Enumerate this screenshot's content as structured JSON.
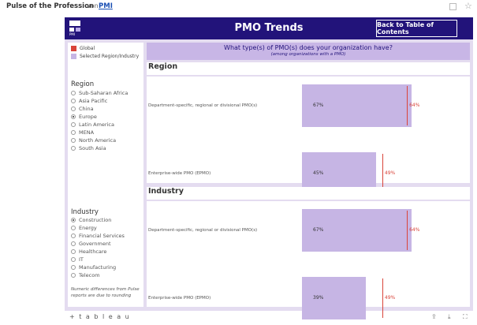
{
  "topbar": {
    "title": "Pulse of the Profession",
    "von": "von",
    "author": "PMI",
    "copy_icon": "copy-icon",
    "star_icon": "☆"
  },
  "header": {
    "logo_text": "PMI",
    "title": "PMO Trends",
    "back_button": "Back to Table of Contents"
  },
  "legend": [
    {
      "label": "Global",
      "color": "#d9443a"
    },
    {
      "label": "Selected Region/Industry",
      "color": "#c6b5e4"
    }
  ],
  "region": {
    "label": "Region",
    "items": [
      {
        "label": "Sub-Saharan Africa",
        "selected": false
      },
      {
        "label": "Asia Pacific",
        "selected": false
      },
      {
        "label": "China",
        "selected": false
      },
      {
        "label": "Europe",
        "selected": true
      },
      {
        "label": "Latin America",
        "selected": false
      },
      {
        "label": "MENA",
        "selected": false
      },
      {
        "label": "North America",
        "selected": false
      },
      {
        "label": "South Asia",
        "selected": false
      }
    ]
  },
  "industry": {
    "label": "Industry",
    "items": [
      {
        "label": "Construction",
        "selected": true
      },
      {
        "label": "Energy",
        "selected": false
      },
      {
        "label": "Financial Services",
        "selected": false
      },
      {
        "label": "Government",
        "selected": false
      },
      {
        "label": "Healthcare",
        "selected": false
      },
      {
        "label": "IT",
        "selected": false
      },
      {
        "label": "Manufacturing",
        "selected": false
      },
      {
        "label": "Telecom",
        "selected": false
      }
    ]
  },
  "note": "Numeric differences from Pulse reports are due to rounding",
  "question": {
    "title": "What type(s) of PMO(s) does your organization have?",
    "subtitle": "(among organizations with a PMO)"
  },
  "sections": {
    "region": {
      "title": "Region",
      "rows": [
        {
          "label": "Department-specific, regional or divisional PMO(s)",
          "value": 67,
          "value_label": "67%",
          "global": 64,
          "global_label": "64%"
        },
        {
          "label": "Enterprise-wide PMO (EPMO)",
          "value": 45,
          "value_label": "45%",
          "global": 49,
          "global_label": "49%"
        }
      ]
    },
    "industry": {
      "title": "Industry",
      "rows": [
        {
          "label": "Department-specific, regional or divisional PMO(s)",
          "value": 67,
          "value_label": "67%",
          "global": 64,
          "global_label": "64%"
        },
        {
          "label": "Enterprise-wide PMO (EPMO)",
          "value": 39,
          "value_label": "39%",
          "global": 49,
          "global_label": "49%"
        }
      ]
    }
  },
  "footer": {
    "brand": "+ t a b l e a u",
    "undo_icon": "↶",
    "redo_icon": "↷",
    "revert_icon": "⇤",
    "share_icon": "⇪",
    "download_icon": "⤓",
    "fullscreen_icon": "⛶"
  }
}
